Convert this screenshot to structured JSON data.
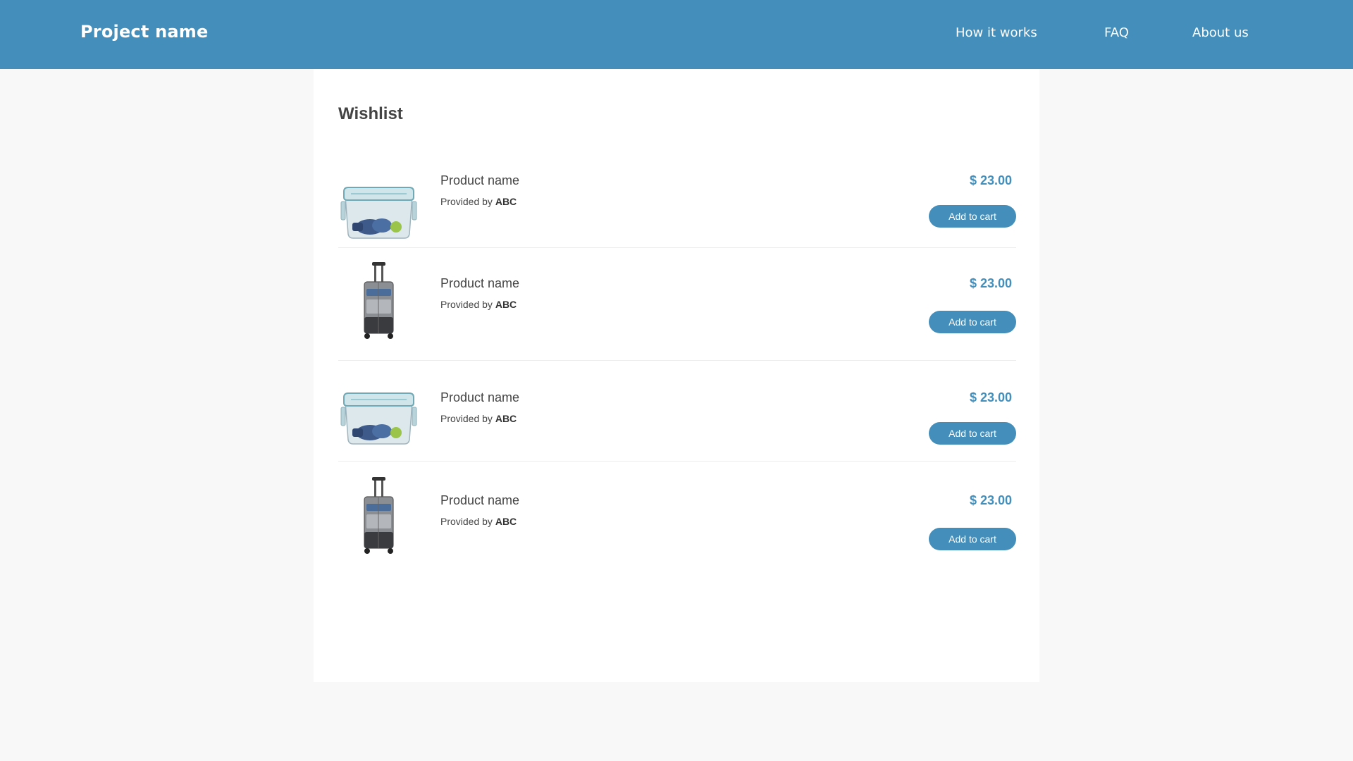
{
  "header": {
    "brand": "Project name",
    "nav": [
      {
        "label": "How it works"
      },
      {
        "label": "FAQ"
      },
      {
        "label": "About us"
      }
    ]
  },
  "wishlist": {
    "title": "Wishlist",
    "items": [
      {
        "name": "Product name",
        "provided_prefix": "Provided by",
        "provider": "ABC",
        "currency": "$",
        "price": "23.00",
        "button": "Add to cart",
        "image": "food-container-icon"
      },
      {
        "name": "Product name",
        "provided_prefix": "Provided by",
        "provider": "ABC",
        "currency": "$",
        "price": "23.00",
        "button": "Add to cart",
        "image": "suitcase-icon"
      },
      {
        "name": "Product name",
        "provided_prefix": "Provided by",
        "provider": "ABC",
        "currency": "$",
        "price": "23.00",
        "button": "Add to cart",
        "image": "food-container-icon"
      },
      {
        "name": "Product name",
        "provided_prefix": "Provided by",
        "provider": "ABC",
        "currency": "$",
        "price": "23.00",
        "button": "Add to cart",
        "image": "suitcase-icon"
      }
    ]
  },
  "colors": {
    "header_bg": "#438eba",
    "accent": "#438eba",
    "page_bg": "#f8f8f8"
  }
}
